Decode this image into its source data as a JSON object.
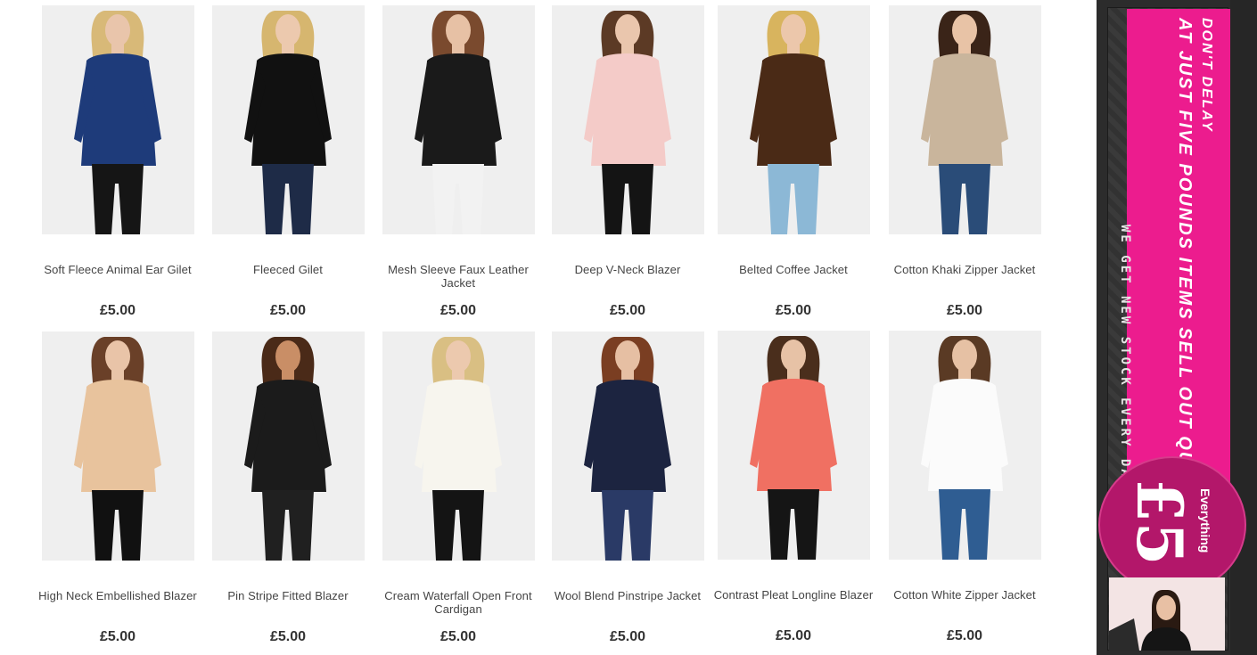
{
  "products": [
    {
      "name": "Soft Fleece Animal Ear Gilet",
      "price": "£5.00",
      "colors": {
        "skin": "#e9c5ab",
        "hair": "#d8b978",
        "top": "#1e3b7a",
        "bottom": "#151515"
      }
    },
    {
      "name": "Fleeced Gilet",
      "price": "£5.00",
      "colors": {
        "skin": "#ecc9ae",
        "hair": "#d6b66f",
        "top": "#111111",
        "bottom": "#1e2b47"
      }
    },
    {
      "name": "Mesh Sleeve Faux Leather Jacket",
      "price": "£5.00",
      "colors": {
        "skin": "#e7c1a5",
        "hair": "#7a4a2e",
        "top": "#1a1a1a",
        "bottom": "#f2f2f2"
      }
    },
    {
      "name": "Deep V-Neck Blazer",
      "price": "£5.00",
      "colors": {
        "skin": "#eac6ad",
        "hair": "#5c3a25",
        "top": "#f4cbc8",
        "bottom": "#141414"
      }
    },
    {
      "name": "Belted Coffee Jacket",
      "price": "£5.00",
      "colors": {
        "skin": "#ecc7ab",
        "hair": "#d8b45e",
        "top": "#4a2a16",
        "bottom": "#8cb8d6"
      }
    },
    {
      "name": "Cotton Khaki Zipper Jacket",
      "price": "£5.00",
      "colors": {
        "skin": "#e8c3a6",
        "hair": "#3a2418",
        "top": "#c9b59c",
        "bottom": "#2a4c78"
      }
    },
    {
      "name": "High Neck Embellished Blazer",
      "price": "£5.00",
      "colors": {
        "skin": "#e9c4a8",
        "hair": "#6a4028",
        "top": "#e8c39d",
        "bottom": "#111111"
      }
    },
    {
      "name": "Pin Stripe Fitted Blazer",
      "price": "£5.00",
      "colors": {
        "skin": "#c98e66",
        "hair": "#4a2a18",
        "top": "#1b1b1b",
        "bottom": "#202020"
      }
    },
    {
      "name": "Cream Waterfall Open Front Cardigan",
      "price": "£5.00",
      "colors": {
        "skin": "#ecc9ae",
        "hair": "#d9bf83",
        "top": "#f7f5ee",
        "bottom": "#141414"
      }
    },
    {
      "name": "Wool Blend Pinstripe Jacket",
      "price": "£5.00",
      "colors": {
        "skin": "#e6bfa3",
        "hair": "#7a3e22",
        "top": "#1c2440",
        "bottom": "#2a3a66"
      }
    },
    {
      "name": "Contrast Pleat Longline Blazer",
      "price": "£5.00",
      "colors": {
        "skin": "#e7c2a6",
        "hair": "#4a2e1c",
        "top": "#f07062",
        "bottom": "#151515"
      }
    },
    {
      "name": "Cotton White Zipper Jacket",
      "price": "£5.00",
      "colors": {
        "skin": "#e6c1a4",
        "hair": "#5a3a24",
        "top": "#fbfbfb",
        "bottom": "#2f5d92"
      }
    }
  ],
  "banner": {
    "line1": "DON'T DELAY",
    "line2": "AT JUST FIVE POUNDS ITEMS SELL OUT QUICKLY!",
    "side_text": "WE GET NEW STOCK EVERY DAY",
    "price": "£5",
    "everything_label": "Everything",
    "colors": {
      "pink": "#ec1c8e",
      "badge": "#b3176a",
      "dark": "#2c2c2c"
    }
  }
}
